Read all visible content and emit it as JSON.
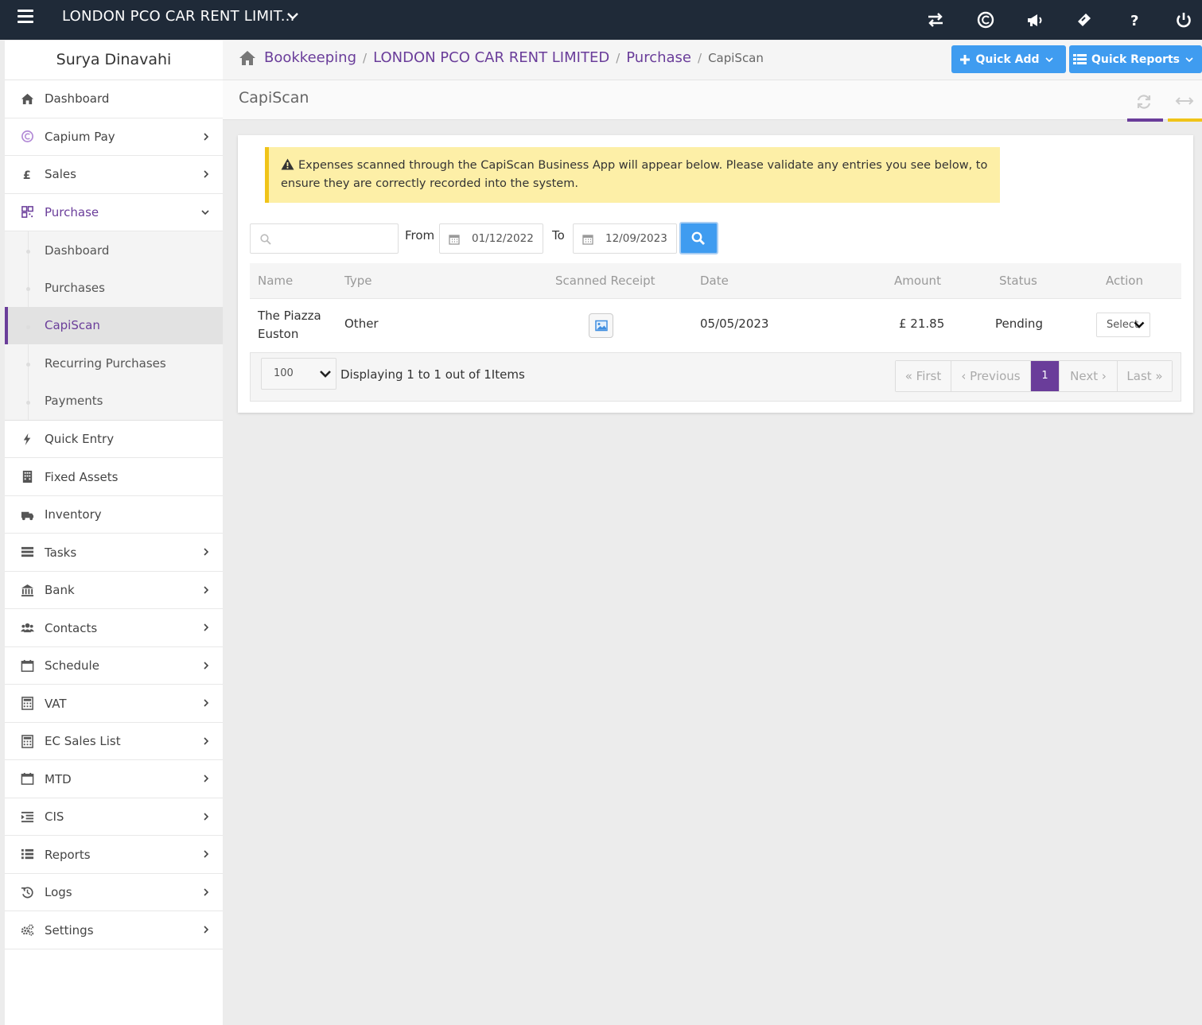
{
  "topbar": {
    "company": "LONDON PCO CAR RENT LIMIT...",
    "icons": [
      "switch-icon",
      "capium-icon",
      "announcement-icon",
      "ticket-icon",
      "help-icon",
      "power-icon"
    ]
  },
  "sidebar": {
    "user_name": "Surya Dinavahi",
    "items_top": [
      {
        "label": "Dashboard",
        "icon": "home-icon",
        "has_children": false
      },
      {
        "label": "Capium Pay",
        "icon": "capium-pay-icon",
        "has_children": true
      },
      {
        "label": "Sales",
        "icon": "pound-icon",
        "has_children": true
      },
      {
        "label": "Purchase",
        "icon": "qrcode-icon",
        "has_children": true,
        "expanded": true
      }
    ],
    "purchase_sub": [
      "Dashboard",
      "Purchases",
      "CapiScan",
      "Recurring Purchases",
      "Payments"
    ],
    "active_sub": "CapiScan",
    "items_bottom": [
      {
        "label": "Quick Entry",
        "icon": "bolt-icon",
        "has_children": false
      },
      {
        "label": "Fixed Assets",
        "icon": "building-icon",
        "has_children": false
      },
      {
        "label": "Inventory",
        "icon": "truck-icon",
        "has_children": false
      },
      {
        "label": "Tasks",
        "icon": "tasks-icon",
        "has_children": true
      },
      {
        "label": "Bank",
        "icon": "bank-icon",
        "has_children": true
      },
      {
        "label": "Contacts",
        "icon": "users-icon",
        "has_children": true
      },
      {
        "label": "Schedule",
        "icon": "calendar-icon",
        "has_children": true
      },
      {
        "label": "VAT",
        "icon": "calculator-icon",
        "has_children": true
      },
      {
        "label": "EC Sales List",
        "icon": "calculator-icon",
        "has_children": true
      },
      {
        "label": "MTD",
        "icon": "calendar-icon",
        "has_children": true
      },
      {
        "label": "CIS",
        "icon": "indent-icon",
        "has_children": true
      },
      {
        "label": "Reports",
        "icon": "list-icon",
        "has_children": true
      },
      {
        "label": "Logs",
        "icon": "history-icon",
        "has_children": true
      },
      {
        "label": "Settings",
        "icon": "cogs-icon",
        "has_children": true
      }
    ]
  },
  "breadcrumb": {
    "items": [
      "Bookkeeping",
      "LONDON PCO CAR RENT LIMITED",
      "Purchase"
    ],
    "current": "CapiScan"
  },
  "quick_add_label": "Quick Add",
  "quick_reports_label": "Quick Reports",
  "page_title": "CapiScan",
  "alert_text": "Expenses scanned through the CapiScan Business App will appear below. Please validate any entries you see below, to ensure they are correctly recorded into the system.",
  "filters": {
    "search_placeholder": "",
    "from_label": "From",
    "from_date": "01/12/2022",
    "to_label": "To",
    "to_date": "12/09/2023"
  },
  "table": {
    "columns": [
      "Name",
      "Type",
      "Scanned Receipt",
      "Date",
      "Amount",
      "Status",
      "Action"
    ],
    "rows": [
      {
        "name": "The Piazza Euston",
        "type": "Other",
        "date": "05/05/2023",
        "amount": "£ 21.85",
        "status": "Pending",
        "action": "Select"
      }
    ]
  },
  "footer": {
    "page_size": "100",
    "display_text": "Displaying 1 to 1 out of 1Items",
    "pager": [
      "« First",
      "‹ Previous",
      "1",
      "Next ›",
      "Last »"
    ]
  },
  "colors": {
    "accent": "#6a3d9a",
    "primary_button": "#3f9cf0",
    "topbar": "#1f2a38",
    "alert_bg": "#fdefa7",
    "alert_border": "#f0c419"
  }
}
